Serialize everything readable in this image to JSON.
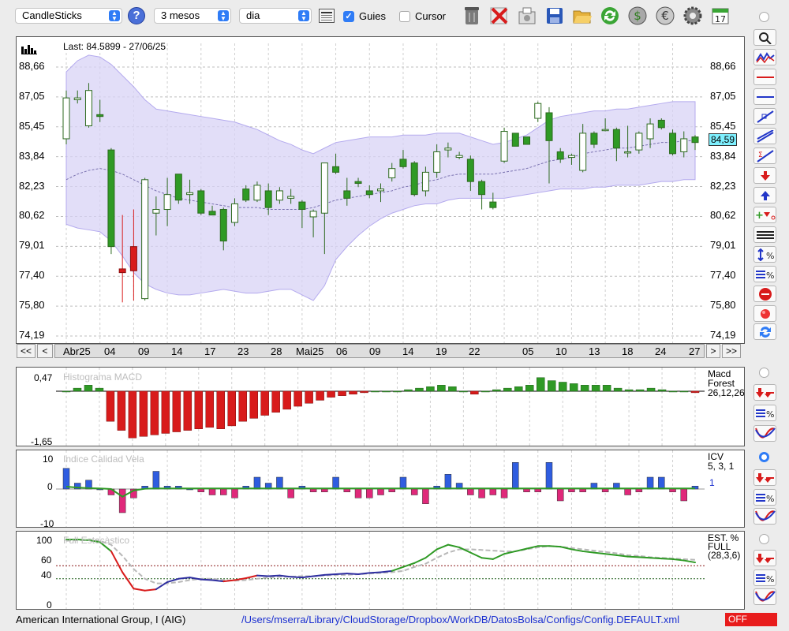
{
  "toolbar": {
    "chart_type": "CandleSticks",
    "period": "3 mesos",
    "interval": "dia",
    "guides_label": "Guies",
    "guides_checked": true,
    "cursor_label": "Cursor",
    "cursor_checked": false,
    "calendar_day": "17"
  },
  "price_panel": {
    "last_label": "Last: 84.5899 - 27/06/25",
    "last_value": "84,59",
    "y_ticks": [
      "88,66",
      "87,05",
      "85,45",
      "83,84",
      "82,23",
      "80,62",
      "79,01",
      "77,40",
      "75,80",
      "74,19"
    ],
    "ylim": [
      74.19,
      88.66
    ],
    "candles": [
      {
        "o": 84.8,
        "h": 87.4,
        "l": 84.5,
        "c": 87.0
      },
      {
        "o": 86.9,
        "h": 87.4,
        "l": 86.7,
        "c": 87.0
      },
      {
        "o": 85.5,
        "h": 87.8,
        "l": 85.4,
        "c": 87.4
      },
      {
        "o": 86.1,
        "h": 86.9,
        "l": 85.7,
        "c": 86.0
      },
      {
        "o": 84.2,
        "h": 84.3,
        "l": 78.6,
        "c": 79.0
      },
      {
        "o": 77.8,
        "h": 80.7,
        "l": 76.0,
        "c": 77.6
      },
      {
        "o": 79.0,
        "h": 81.0,
        "l": 76.1,
        "c": 77.7
      },
      {
        "o": 76.2,
        "h": 82.7,
        "l": 76.1,
        "c": 82.6
      },
      {
        "o": 80.8,
        "h": 81.7,
        "l": 79.6,
        "c": 81.0
      },
      {
        "o": 81.0,
        "h": 82.7,
        "l": 80.1,
        "c": 81.8
      },
      {
        "o": 82.9,
        "h": 82.9,
        "l": 81.3,
        "c": 81.5
      },
      {
        "o": 81.8,
        "h": 82.6,
        "l": 81.3,
        "c": 81.9
      },
      {
        "o": 82.0,
        "h": 82.1,
        "l": 80.7,
        "c": 80.8
      },
      {
        "o": 80.9,
        "h": 81.2,
        "l": 80.7,
        "c": 80.7
      },
      {
        "o": 81.0,
        "h": 81.1,
        "l": 78.8,
        "c": 79.3
      },
      {
        "o": 80.3,
        "h": 81.6,
        "l": 80.1,
        "c": 81.3
      },
      {
        "o": 82.1,
        "h": 82.3,
        "l": 81.4,
        "c": 81.5
      },
      {
        "o": 81.5,
        "h": 82.5,
        "l": 81.4,
        "c": 82.3
      },
      {
        "o": 82.0,
        "h": 82.4,
        "l": 80.7,
        "c": 81.1
      },
      {
        "o": 81.5,
        "h": 82.2,
        "l": 81.3,
        "c": 82.0
      },
      {
        "o": 81.6,
        "h": 82.1,
        "l": 81.3,
        "c": 81.7
      },
      {
        "o": 81.4,
        "h": 81.5,
        "l": 80.0,
        "c": 81.0
      },
      {
        "o": 80.6,
        "h": 81.0,
        "l": 79.5,
        "c": 80.9
      },
      {
        "o": 80.8,
        "h": 83.3,
        "l": 78.6,
        "c": 83.5
      },
      {
        "o": 83.3,
        "h": 84.0,
        "l": 82.9,
        "c": 83.0
      },
      {
        "o": 82.0,
        "h": 82.7,
        "l": 81.2,
        "c": 81.6
      },
      {
        "o": 82.5,
        "h": 82.7,
        "l": 82.2,
        "c": 82.4
      },
      {
        "o": 82.0,
        "h": 82.3,
        "l": 81.6,
        "c": 81.8
      },
      {
        "o": 82.0,
        "h": 82.4,
        "l": 81.4,
        "c": 82.1
      },
      {
        "o": 82.7,
        "h": 83.5,
        "l": 82.5,
        "c": 83.2
      },
      {
        "o": 83.7,
        "h": 84.2,
        "l": 83.2,
        "c": 83.3
      },
      {
        "o": 83.5,
        "h": 83.6,
        "l": 81.7,
        "c": 81.8
      },
      {
        "o": 82.0,
        "h": 83.3,
        "l": 81.7,
        "c": 83.0
      },
      {
        "o": 83.0,
        "h": 84.5,
        "l": 82.7,
        "c": 84.1
      },
      {
        "o": 84.2,
        "h": 84.6,
        "l": 83.8,
        "c": 84.3
      },
      {
        "o": 83.8,
        "h": 84.1,
        "l": 83.7,
        "c": 83.9
      },
      {
        "o": 83.7,
        "h": 83.9,
        "l": 82.0,
        "c": 82.5
      },
      {
        "o": 82.5,
        "h": 82.6,
        "l": 81.0,
        "c": 81.8
      },
      {
        "o": 81.4,
        "h": 81.9,
        "l": 81.0,
        "c": 81.1
      },
      {
        "o": 83.6,
        "h": 85.4,
        "l": 83.5,
        "c": 85.2
      },
      {
        "o": 85.1,
        "h": 85.1,
        "l": 84.4,
        "c": 84.4
      },
      {
        "o": 84.9,
        "h": 84.9,
        "l": 84.5,
        "c": 84.5
      },
      {
        "o": 85.9,
        "h": 86.8,
        "l": 85.7,
        "c": 86.7
      },
      {
        "o": 86.2,
        "h": 86.5,
        "l": 82.4,
        "c": 84.7
      },
      {
        "o": 84.1,
        "h": 84.3,
        "l": 83.5,
        "c": 83.7
      },
      {
        "o": 83.8,
        "h": 84.0,
        "l": 83.4,
        "c": 83.9
      },
      {
        "o": 83.1,
        "h": 85.6,
        "l": 83.0,
        "c": 85.1
      },
      {
        "o": 85.1,
        "h": 85.2,
        "l": 84.3,
        "c": 84.5
      },
      {
        "o": 85.3,
        "h": 85.9,
        "l": 85.2,
        "c": 85.3
      },
      {
        "o": 85.3,
        "h": 85.4,
        "l": 83.6,
        "c": 84.3
      },
      {
        "o": 84.1,
        "h": 85.5,
        "l": 83.8,
        "c": 84.1
      },
      {
        "o": 84.2,
        "h": 85.2,
        "l": 84.0,
        "c": 85.1
      },
      {
        "o": 84.8,
        "h": 85.9,
        "l": 84.3,
        "c": 85.6
      },
      {
        "o": 85.8,
        "h": 85.9,
        "l": 85.3,
        "c": 85.4
      },
      {
        "o": 85.1,
        "h": 85.3,
        "l": 83.9,
        "c": 84.0
      },
      {
        "o": 84.1,
        "h": 85.2,
        "l": 83.8,
        "c": 84.8
      },
      {
        "o": 84.9,
        "h": 85.0,
        "l": 84.2,
        "c": 84.6
      }
    ],
    "band_upper": [
      88.4,
      89.0,
      89.3,
      89.2,
      88.8,
      88.2,
      87.6,
      86.9,
      86.4,
      86.3,
      86.2,
      86.1,
      86.0,
      85.9,
      85.8,
      85.7,
      85.5,
      85.3,
      85.0,
      84.7,
      84.5,
      84.2,
      84.0,
      84.3,
      84.6,
      84.7,
      84.8,
      84.9,
      84.9,
      84.9,
      85.0,
      85.0,
      85.0,
      85.1,
      85.1,
      85.1,
      84.9,
      84.7,
      84.5,
      84.6,
      84.8,
      85.0,
      85.4,
      85.8,
      86.0,
      86.1,
      86.2,
      86.3,
      86.3,
      86.4,
      86.4,
      86.5,
      86.6,
      86.7,
      86.8,
      86.8,
      86.8
    ],
    "band_middle": [
      82.6,
      82.9,
      83.1,
      83.2,
      83.1,
      82.9,
      82.6,
      82.3,
      82.0,
      81.8,
      81.6,
      81.5,
      81.4,
      81.3,
      81.2,
      81.1,
      81.1,
      81.1,
      81.0,
      81.0,
      81.0,
      81.0,
      81.1,
      81.3,
      81.5,
      81.6,
      81.7,
      81.8,
      81.9,
      82.0,
      82.2,
      82.3,
      82.5,
      82.6,
      82.8,
      82.9,
      82.9,
      82.9,
      82.9,
      83.0,
      83.1,
      83.2,
      83.4,
      83.6,
      83.7,
      83.8,
      84.0,
      84.1,
      84.2,
      84.3,
      84.3,
      84.4,
      84.5,
      84.6,
      84.6,
      84.7,
      84.7
    ],
    "band_lower": [
      80.2,
      80.0,
      79.9,
      79.8,
      79.3,
      78.5,
      77.6,
      77.0,
      76.7,
      76.5,
      76.4,
      76.4,
      76.5,
      76.6,
      76.7,
      76.6,
      76.5,
      76.5,
      76.6,
      76.7,
      76.7,
      76.4,
      76.1,
      76.9,
      78.3,
      79.0,
      79.6,
      80.1,
      80.5,
      80.8,
      81.0,
      81.2,
      81.3,
      81.3,
      81.5,
      81.6,
      81.6,
      81.6,
      81.6,
      81.6,
      81.7,
      81.8,
      81.9,
      82.0,
      82.1,
      82.1,
      82.1,
      82.2,
      82.2,
      82.3,
      82.3,
      82.3,
      82.4,
      82.5,
      82.5,
      82.6,
      82.6
    ]
  },
  "date_bar": {
    "first": "<<",
    "prev": "<",
    "next": ">",
    "last": ">>",
    "labels": [
      "Abr25",
      "04",
      "09",
      "14",
      "17",
      "23",
      "28",
      "Mai25",
      "06",
      "09",
      "14",
      "19",
      "22",
      "05",
      "10",
      "13",
      "18",
      "24",
      "27"
    ]
  },
  "macd_panel": {
    "title": "Histograma MACD",
    "y_top": "0,47",
    "y_bottom": "-1,65",
    "ylim": [
      -1.65,
      0.47
    ],
    "side_label": [
      "Macd",
      "Forest",
      "26,12,26"
    ],
    "values": [
      0.0,
      0.1,
      0.2,
      0.1,
      -1.0,
      -1.3,
      -1.55,
      -1.5,
      -1.45,
      -1.4,
      -1.35,
      -1.3,
      -1.25,
      -1.2,
      -1.25,
      -1.15,
      -1.0,
      -0.9,
      -0.8,
      -0.7,
      -0.6,
      -0.5,
      -0.4,
      -0.3,
      -0.2,
      -0.15,
      -0.1,
      -0.05,
      0.0,
      0.0,
      0.0,
      0.05,
      0.1,
      0.15,
      0.2,
      0.15,
      0.0,
      -0.1,
      0.0,
      0.05,
      0.1,
      0.15,
      0.2,
      0.45,
      0.35,
      0.3,
      0.25,
      0.2,
      0.2,
      0.2,
      0.1,
      0.05,
      0.05,
      0.1,
      0.05,
      0.0,
      0.0,
      -0.05
    ]
  },
  "icv_panel": {
    "title": "Indice Calidad Vela",
    "y_top": "10",
    "y_zero": "0",
    "y_bottom": "-10",
    "ylim": [
      -12,
      12
    ],
    "side_label": [
      "ICV",
      "5, 3, 1"
    ],
    "side_value": "1",
    "values": [
      7,
      2,
      3,
      0,
      -2,
      -8,
      -3,
      1,
      6,
      1,
      1,
      0,
      -1,
      -2,
      -2,
      -3,
      1,
      4,
      2,
      4,
      -3,
      1,
      -1,
      -1,
      4,
      -1,
      -3,
      -3,
      -2,
      -1,
      4,
      -2,
      -5,
      1,
      5,
      2,
      -2,
      -3,
      -2,
      -3,
      9,
      -1,
      -1,
      9,
      -4,
      -1,
      -1,
      2,
      -1,
      2,
      -2,
      -1,
      4,
      4,
      -1,
      -4,
      1
    ],
    "signal": [
      0.8,
      0.5,
      0.3,
      0.2,
      0.0,
      -2.6,
      -0.5,
      0.1,
      0.2,
      0.2,
      0.2,
      0.2,
      0.2,
      0.2,
      0.2,
      0.2,
      0.2,
      0.2,
      0.2,
      0.2,
      0.2,
      0.2,
      0.2,
      0.2,
      0.2,
      0.2,
      0.2,
      0.2,
      0.2,
      0.2,
      0.2,
      0.2,
      0.2,
      0.2,
      0.2,
      0.2,
      0.2,
      0.2,
      0.2,
      0.2,
      0.2,
      0.2,
      0.2,
      0.2,
      0.2,
      0.2,
      0.2,
      0.2,
      0.2,
      0.2,
      0.2,
      0.2,
      0.2,
      0.2,
      0.2,
      0.2,
      0.2
    ]
  },
  "stoch_panel": {
    "title": "Full Estocàstico",
    "y_ticks": [
      "100",
      "60",
      "40",
      "0"
    ],
    "ylim": [
      0,
      100
    ],
    "side_label": [
      "EST. %",
      "FULL",
      "(28,3,6)"
    ],
    "k_line": [
      100,
      100,
      99,
      96,
      82,
      50,
      25,
      22,
      24,
      35,
      40,
      42,
      39,
      38,
      36,
      38,
      41,
      45,
      44,
      45,
      43,
      42,
      44,
      46,
      47,
      48,
      47,
      49,
      50,
      52,
      58,
      64,
      72,
      85,
      92,
      88,
      80,
      72,
      70,
      78,
      82,
      86,
      90,
      90,
      89,
      85,
      82,
      80,
      78,
      76,
      74,
      73,
      72,
      71,
      70,
      68,
      65
    ],
    "d_line": [
      98,
      99,
      99,
      98,
      92,
      75,
      55,
      40,
      33,
      33,
      35,
      38,
      40,
      40,
      38,
      37,
      38,
      40,
      42,
      43,
      43,
      44,
      44,
      45,
      46,
      46,
      47,
      48,
      49,
      50,
      52,
      58,
      63,
      72,
      80,
      85,
      85,
      84,
      83,
      82,
      82,
      85,
      88,
      90,
      89,
      87,
      85,
      83,
      81,
      79,
      76,
      75,
      73,
      72,
      71,
      70,
      69
    ]
  },
  "status_bar": {
    "company": "American International Group, I (AIG)",
    "path": "/Users/mserra/Library/CloudStorage/Dropbox/WorkDB/DatosBolsa/Configs/Config.DEFAULT.xml",
    "toggle": "OFF"
  },
  "colors": {
    "up": "#2f9a25",
    "down": "#d81b1b",
    "band": "#d8d3f5",
    "accent": "#2f7cf6"
  }
}
